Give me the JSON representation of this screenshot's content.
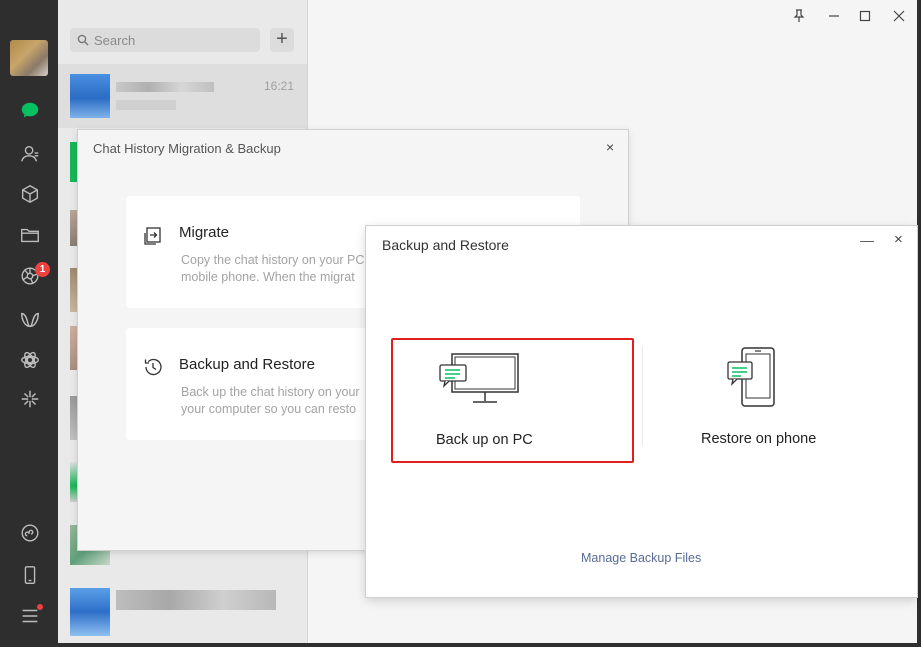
{
  "sidebar": {
    "badge_count": "1",
    "icons": [
      "avatar",
      "chat-icon",
      "contacts-icon",
      "favorites-icon",
      "files-icon",
      "moments-icon",
      "channels-icon",
      "mini-programs-icon",
      "search-discover-icon",
      "miniprogram-icon",
      "phone-icon",
      "menu-icon"
    ]
  },
  "chat_list": {
    "search_placeholder": "Search",
    "add_label": "+",
    "first_time": "16:21"
  },
  "window": {
    "pin_icon": "pin-icon",
    "minimize_icon": "minimize-icon",
    "maximize_icon": "maximize-icon",
    "close_icon": "close-icon"
  },
  "migration_dialog": {
    "title": "Chat History Migration & Backup",
    "close": "×",
    "migrate": {
      "title": "Migrate",
      "desc_line1": "Copy the chat history on your PC",
      "desc_line2": "mobile phone. When the migrat"
    },
    "backup": {
      "title": "Backup and Restore",
      "desc_line1": "Back up the chat history on your",
      "desc_line2": "your computer so you can resto"
    }
  },
  "backup_dialog": {
    "title": "Backup and Restore",
    "minimize": "—",
    "close": "×",
    "backup_pc_label": "Back up on PC",
    "restore_phone_label": "Restore on phone",
    "manage_link": "Manage Backup Files",
    "highlight_color": "#e02020",
    "accent_green": "#07c160"
  }
}
